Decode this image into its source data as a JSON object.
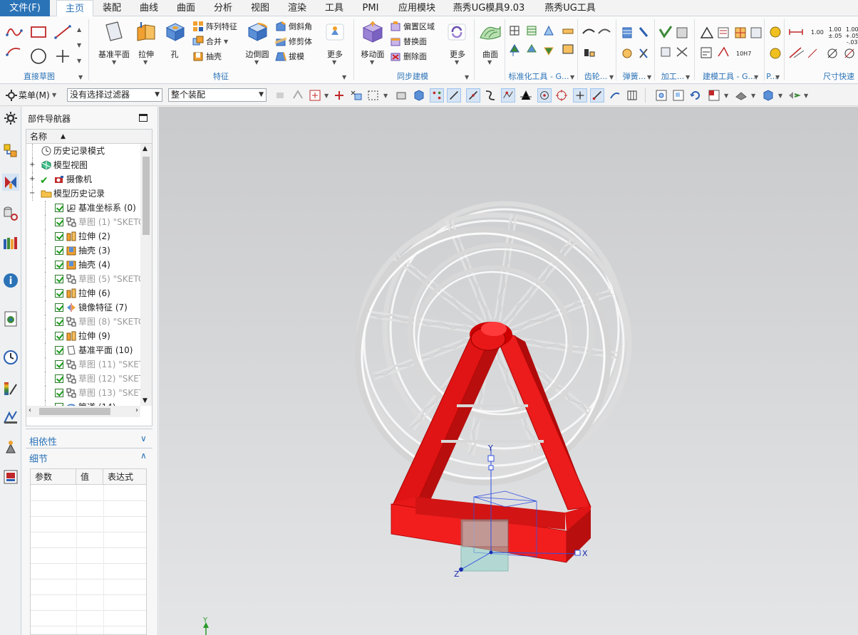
{
  "tabs": [
    "文件(F)",
    "主页",
    "装配",
    "曲线",
    "曲面",
    "分析",
    "视图",
    "渲染",
    "工具",
    "PMI",
    "应用模块",
    "燕秀UG模具9.03",
    "燕秀UG工具"
  ],
  "ribbon": {
    "groups": {
      "sketch": "直接草图",
      "feature": "特征",
      "sync": "同步建模",
      "std": "标准化工具 - G...",
      "gear": "齿轮...",
      "spring": "弹簧...",
      "machining": "加工...",
      "modeling": "建模工具 - G...",
      "p": "P...",
      "dim": "尺寸快速"
    },
    "feature": {
      "datum_plane": "基准平面",
      "extrude": "拉伸",
      "hole": "孔",
      "pattern": "阵列特征",
      "unite": "合并",
      "shell": "抽壳",
      "edge_blend": "边倒圆",
      "chamfer": "倒斜角",
      "trim_body": "修剪体",
      "draft": "拔模",
      "more": "更多"
    },
    "sync": {
      "move_face": "移动面",
      "offset_region": "偏置区域",
      "replace_face": "替换面",
      "delete_face": "删除面",
      "more": "更多"
    },
    "surface": {
      "label": "曲面"
    },
    "dim_tools": {
      "v1": "1.00",
      "v2_top": "1.00",
      "v2_bot": "±.05",
      "v3_top": "1.00",
      "v3_bot": "+.05\n-.03",
      "tol_label": "10H7"
    }
  },
  "toolbar": {
    "menu": "菜单(M)",
    "filter": "没有选择过滤器",
    "assembly": "整个装配"
  },
  "navigator": {
    "title": "部件导航器",
    "col_name": "名称",
    "rows": [
      {
        "label": "历史记录模式",
        "icon": "clock-icon",
        "dim": false
      },
      {
        "label": "模型视图",
        "icon": "model-view-icon",
        "dim": false
      },
      {
        "label": "摄像机",
        "icon": "camera-icon",
        "dim": false
      },
      {
        "label": "模型历史记录",
        "icon": "folder-icon",
        "dim": false
      },
      {
        "label": "基准坐标系 (0)",
        "icon": "datum-csys-icon",
        "dim": false
      },
      {
        "label": "草图 (1) \"SKETC",
        "icon": "sketch-icon",
        "dim": true
      },
      {
        "label": "拉伸 (2)",
        "icon": "extrude-icon",
        "dim": false
      },
      {
        "label": "抽壳 (3)",
        "icon": "shell-icon",
        "dim": false
      },
      {
        "label": "抽壳 (4)",
        "icon": "shell-icon",
        "dim": false
      },
      {
        "label": "草图 (5) \"SKETC",
        "icon": "sketch-icon",
        "dim": true
      },
      {
        "label": "拉伸 (6)",
        "icon": "extrude-icon",
        "dim": false
      },
      {
        "label": "镜像特征 (7)",
        "icon": "mirror-icon",
        "dim": false
      },
      {
        "label": "草图 (8) \"SKETC",
        "icon": "sketch-icon",
        "dim": true
      },
      {
        "label": "拉伸 (9)",
        "icon": "extrude-icon",
        "dim": false
      },
      {
        "label": "基准平面 (10)",
        "icon": "datum-plane-icon",
        "dim": false
      },
      {
        "label": "草图 (11) \"SKET",
        "icon": "sketch-icon",
        "dim": true
      },
      {
        "label": "草图 (12) \"SKET",
        "icon": "sketch-icon",
        "dim": true
      },
      {
        "label": "草图 (13) \"SKET",
        "icon": "sketch-icon",
        "dim": true
      },
      {
        "label": "管道 (14)",
        "icon": "tube-icon",
        "dim": false
      }
    ],
    "dependency": "相依性",
    "details": "细节",
    "detail_cols": [
      "参数",
      "值",
      "表达式"
    ]
  },
  "viewport": {
    "axis_x": "X",
    "axis_y": "Y",
    "axis_z": "Z",
    "wcs_y": "Y",
    "frame_color": "#ec1c1c",
    "wheel_color": "#f4f4f4"
  }
}
